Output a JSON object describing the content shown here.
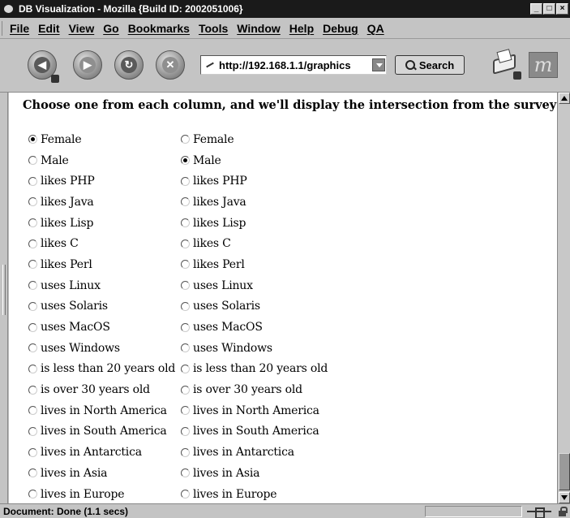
{
  "window": {
    "title": "DB Visualization - Mozilla {Build ID: 2002051006}",
    "buttons": [
      "_",
      "□",
      "×"
    ]
  },
  "menubar": {
    "items": [
      "File",
      "Edit",
      "View",
      "Go",
      "Bookmarks",
      "Tools",
      "Window",
      "Help",
      "Debug",
      "QA"
    ]
  },
  "toolbar": {
    "url": "http://192.168.1.1/graphics",
    "search_label": "Search",
    "logo_letter": "m",
    "nav_buttons": [
      "back-icon",
      "forward-icon",
      "reload-icon",
      "stop-icon"
    ]
  },
  "page": {
    "heading": "Choose one from each column, and we'll display the intersection from the survey data:",
    "left_column": {
      "selected_index": 0,
      "options": [
        "Female",
        "Male",
        "likes PHP",
        "likes Java",
        "likes Lisp",
        "likes C",
        "likes Perl",
        "uses Linux",
        "uses Solaris",
        "uses MacOS",
        "uses Windows",
        "is less than 20 years old",
        "is over 30 years old",
        "lives in North America",
        "lives in South America",
        "lives in Antarctica",
        "lives in Asia",
        "lives in Europe"
      ]
    },
    "right_column": {
      "selected_index": 1,
      "options": [
        "Female",
        "Male",
        "likes PHP",
        "likes Java",
        "likes Lisp",
        "likes C",
        "likes Perl",
        "uses Linux",
        "uses Solaris",
        "uses MacOS",
        "uses Windows",
        "is less than 20 years old",
        "is over 30 years old",
        "lives in North America",
        "lives in South America",
        "lives in Antarctica",
        "lives in Asia",
        "lives in Europe"
      ]
    }
  },
  "statusbar": {
    "text": "Document: Done (1.1 secs)"
  }
}
